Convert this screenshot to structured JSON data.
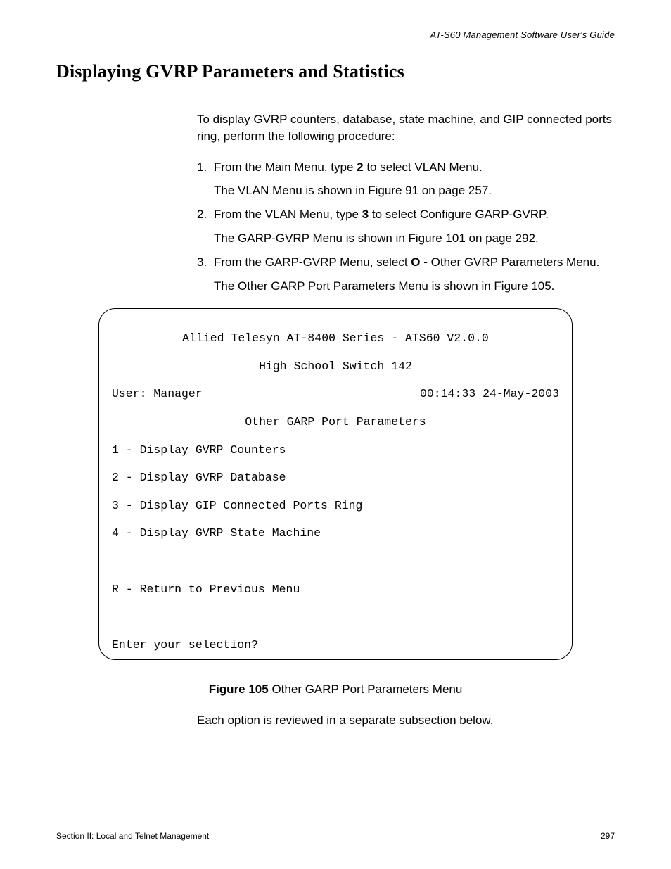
{
  "header": "AT-S60 Management Software User's Guide",
  "title": "Displaying GVRP Parameters and Statistics",
  "intro": "To display GVRP counters, database, state machine, and GIP connected ports ring, perform the following procedure:",
  "steps": [
    {
      "num": "1.",
      "text_before": "From the Main Menu, type ",
      "key": "2",
      "text_after": " to select VLAN Menu.",
      "sub": "The VLAN Menu is shown in Figure 91 on page 257."
    },
    {
      "num": "2.",
      "text_before": "From the VLAN Menu, type ",
      "key": "3",
      "text_after": " to select Configure GARP-GVRP.",
      "sub": "The GARP-GVRP Menu is shown in Figure 101 on page 292."
    },
    {
      "num": "3.",
      "text_before": "From the GARP-GVRP Menu, select ",
      "key": "O",
      "text_after": " - Other GVRP Parameters Menu.",
      "sub": "The Other GARP Port Parameters Menu is shown in Figure 105."
    }
  ],
  "terminal": {
    "line1": "Allied Telesyn AT-8400 Series - ATS60 V2.0.0",
    "line2": "High School Switch 142",
    "user": "User: Manager",
    "datetime": "00:14:33 24-May-2003",
    "subtitle": "Other GARP Port Parameters",
    "opts": [
      "1 - Display GVRP Counters",
      "2 - Display GVRP Database",
      "3 - Display GIP Connected Ports Ring",
      "4 - Display GVRP State Machine"
    ],
    "return": "R - Return to Previous Menu",
    "prompt": "Enter your selection?"
  },
  "figure_label": "Figure 105",
  "figure_text": "  Other GARP Port Parameters Menu",
  "closing": "Each option is reviewed in a separate subsection below.",
  "footer_left": "Section II: Local and Telnet Management",
  "footer_right": "297"
}
